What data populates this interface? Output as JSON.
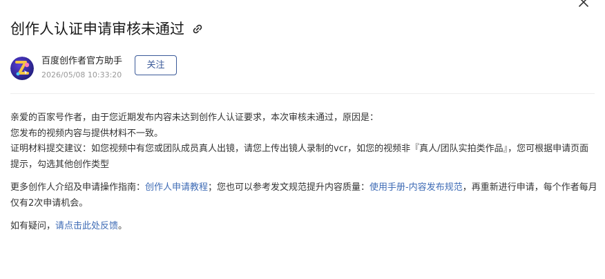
{
  "article": {
    "title": "创作人认证申请审核未通过"
  },
  "author": {
    "name": "百度创作者官方助手",
    "publish_time": "2026/05/08 10:33:20",
    "follow_label": "关注"
  },
  "body": {
    "p1_line1": "亲爱的百家号作者，由于您近期发布内容未达到创作人认证要求，本次审核未通过，原因是：",
    "p1_line2": "您发布的视频内容与提供材料不一致。",
    "p1_line3": "证明材料提交建议：如您视频中有您或团队成员真人出镜，请您上传出镜人录制的vcr，如您的视频非『真人/团队实拍类作品』，您可根据申请页面提示，勾选其他创作类型",
    "p2_prefix": "更多创作人介绍及申请操作指南：",
    "p2_link1": "创作人申请教程",
    "p2_middle": "；您也可以参考发文规范提升内容质量：",
    "p2_link2": "使用手册-内容发布规范",
    "p2_suffix": "，再重新进行申请，每个作者每月仅有2次申请机会。",
    "p3_prefix": "如有疑问，",
    "p3_link": "请点击此处反馈",
    "p3_suffix": "。"
  },
  "colors": {
    "link": "#3e6bb5",
    "follow_border": "#3a5998",
    "divider": "#eeeeee"
  },
  "icons": {
    "close": "close-icon",
    "link": "link-icon",
    "avatar": "baijiahao-assistant-avatar"
  }
}
